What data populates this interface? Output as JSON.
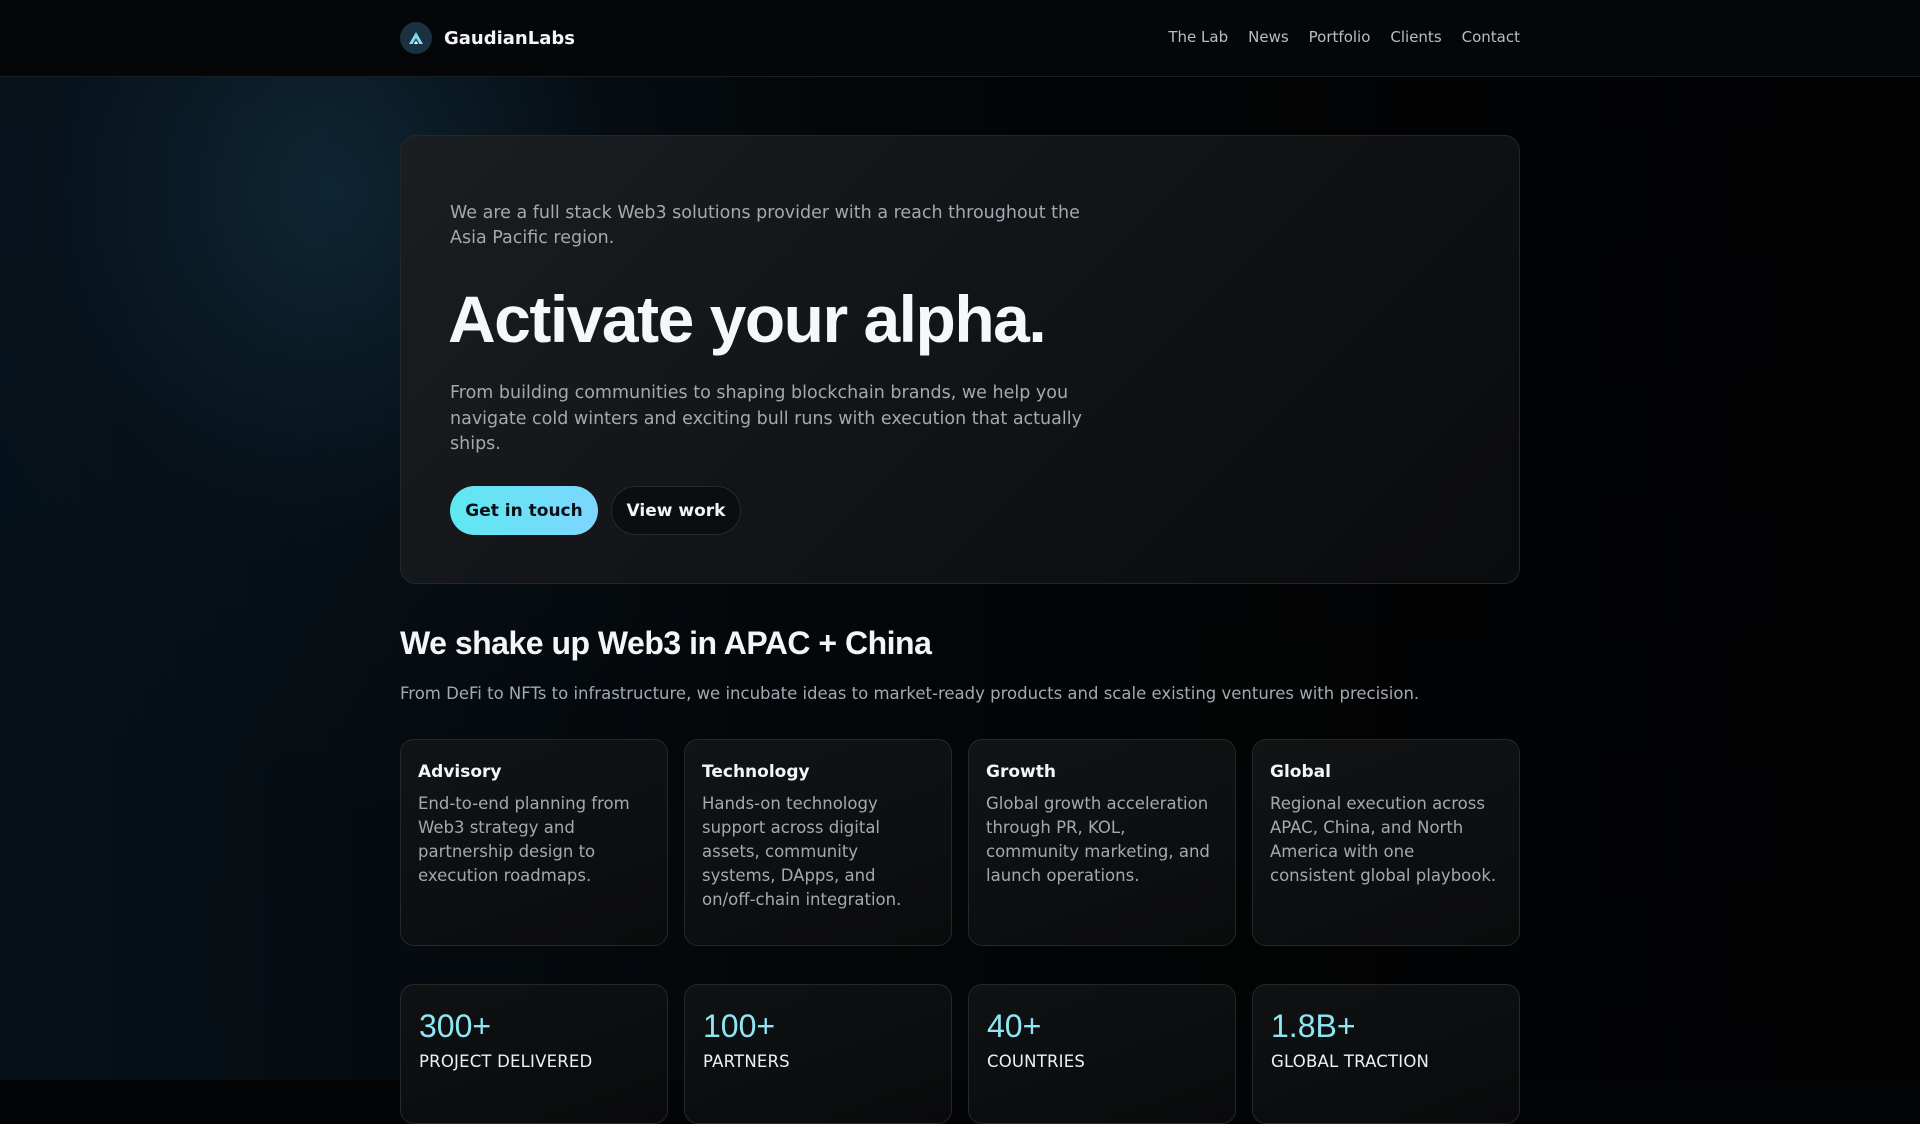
{
  "header": {
    "brand": "GaudianLabs",
    "logo_icon": "mountain-peak-logo",
    "nav": [
      {
        "label": "The Lab"
      },
      {
        "label": "News"
      },
      {
        "label": "Portfolio"
      },
      {
        "label": "Clients"
      },
      {
        "label": "Contact"
      }
    ]
  },
  "hero": {
    "intro": "We are a full stack Web3 solutions provider with a reach throughout the Asia Pacific region.",
    "title": "Activate your alpha.",
    "description": "From building communities to shaping blockchain brands, we help you navigate cold winters and exciting bull runs with execution that actually ships.",
    "primary_button": "Get in touch",
    "secondary_button": "View work"
  },
  "section": {
    "title": "We shake up Web3 in APAC + China",
    "subtitle": "From DeFi to NFTs to infrastructure, we incubate ideas to market-ready products and scale existing ventures with precision."
  },
  "services": [
    {
      "title": "Advisory",
      "body": "End-to-end planning from Web3 strategy and partnership design to execution roadmaps."
    },
    {
      "title": "Technology",
      "body": "Hands-on technology support across digital assets, community systems, DApps, and on/off-chain integration."
    },
    {
      "title": "Growth",
      "body": "Global growth acceleration through PR, KOL, community marketing, and launch operations."
    },
    {
      "title": "Global",
      "body": "Regional execution across APAC, China, and North America with one consistent global playbook."
    }
  ],
  "stats": [
    {
      "value": "300+",
      "label": "PROJECT DELIVERED"
    },
    {
      "value": "100+",
      "label": "PARTNERS"
    },
    {
      "value": "40+",
      "label": "COUNTRIES"
    },
    {
      "value": "1.8B+",
      "label": "GLOBAL TRACTION"
    }
  ],
  "colors": {
    "accent": "#7dd6ff",
    "accent_start": "#5fe8f0",
    "background": "#030405",
    "stat_value": "#8fe6f2"
  }
}
